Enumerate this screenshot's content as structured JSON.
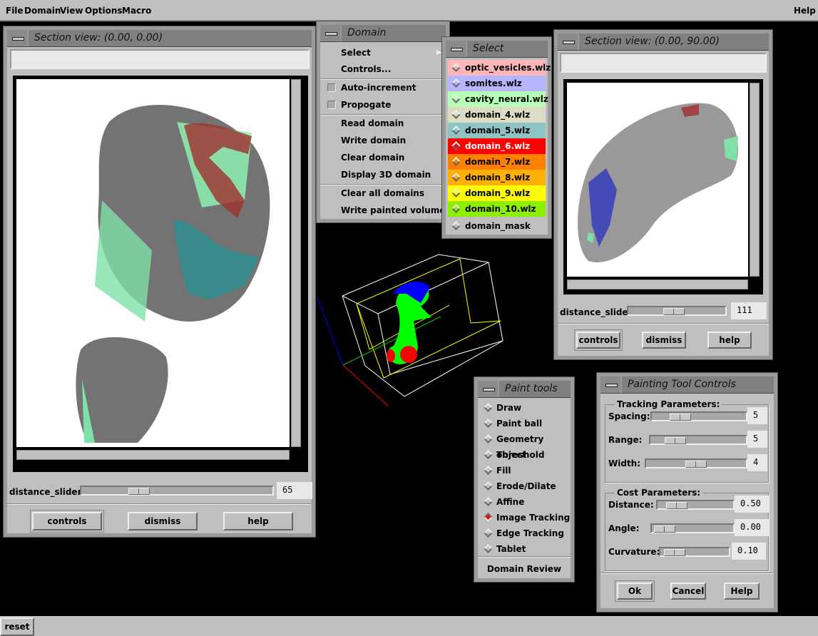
{
  "menubar": {
    "items": [
      "File",
      "Domain",
      "View",
      "Options",
      "Macro"
    ],
    "help": "Help"
  },
  "section_view_1": {
    "title": "Section view: (0.00, 0.00)",
    "slider_label": "distance_slider",
    "slider_value": "65",
    "slider_fraction": 0.33,
    "buttons": [
      "controls",
      "dismiss",
      "help"
    ]
  },
  "section_view_2": {
    "title": "Section view: (0.00, 90.00)",
    "slider_label": "distance_slider",
    "slider_value": "111",
    "slider_fraction": 0.45,
    "buttons": [
      "controls",
      "dismiss",
      "help"
    ]
  },
  "domain_menu": {
    "title": "Domain",
    "items": [
      "Select",
      "Controls...",
      "Auto-increment",
      "Propogate",
      "Read domain",
      "Write domain",
      "Clear domain",
      "Display 3D domain",
      "Clear all domains",
      "Write painted volume"
    ]
  },
  "select_menu": {
    "title": "Select",
    "items": [
      {
        "label": "optic_vesicles.wlz",
        "color": "#ffb6b6"
      },
      {
        "label": "somites.wlz",
        "color": "#b6b6ff"
      },
      {
        "label": "cavity_neural.wlz",
        "color": "#b6ffb6"
      },
      {
        "label": "domain_4.wlz",
        "color": "#dcdcc4"
      },
      {
        "label": "domain_5.wlz",
        "color": "#8ec4c4"
      },
      {
        "label": "domain_6.wlz",
        "color": "#ff0000"
      },
      {
        "label": "domain_7.wlz",
        "color": "#ff8000"
      },
      {
        "label": "domain_8.wlz",
        "color": "#ffb000"
      },
      {
        "label": "domain_9.wlz",
        "color": "#ffff00"
      },
      {
        "label": "domain_10.wlz",
        "color": "#8cf000"
      },
      {
        "label": "domain_mask",
        "color": "#bfbfbf"
      }
    ]
  },
  "paint_tools": {
    "title": "Paint tools",
    "items": [
      "Draw",
      "Paint ball",
      "Geometry object",
      "Threshold",
      "Fill",
      "Erode/Dilate",
      "Affine",
      "Image Tracking",
      "Edge Tracking",
      "Tablet"
    ],
    "selected": "Image Tracking",
    "footer": "Domain Review"
  },
  "painting_controls": {
    "title": "Painting Tool Controls",
    "tracking": {
      "label": "Tracking Parameters:",
      "params": [
        {
          "label": "Spacing:",
          "value": "5"
        },
        {
          "label": "Range:",
          "value": "5"
        },
        {
          "label": "Width:",
          "value": "4"
        }
      ]
    },
    "cost": {
      "label": "Cost Parameters:",
      "params": [
        {
          "label": "Distance:",
          "value": "0.50"
        },
        {
          "label": "Angle:",
          "value": "0.00"
        },
        {
          "label": "Curvature:",
          "value": "0.10"
        }
      ]
    },
    "buttons": [
      "Ok",
      "Cancel",
      "Help"
    ]
  },
  "reset_label": "reset"
}
